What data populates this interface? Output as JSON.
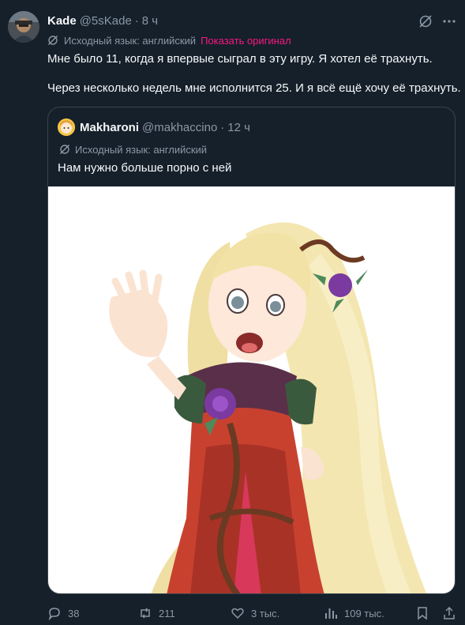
{
  "tweet": {
    "author_name": "Kade",
    "author_handle": "@5sKade",
    "separator": "·",
    "time": "8 ч",
    "translation_note": "Исходный язык: английский",
    "show_original_label": "Показать оригинал",
    "text_line1": "Мне было 11, когда я впервые сыграл в эту игру. Я хотел её трахнуть.",
    "text_line2": "Через несколько недель мне исполнится 25. И я всё ещё хочу её трахнуть."
  },
  "quoted": {
    "author_name": "Makharoni",
    "author_handle": "@makhaccino",
    "separator": "·",
    "time": "12 ч",
    "translation_note": "Исходный язык: английский",
    "text": "Нам нужно больше порно с ней"
  },
  "actions": {
    "replies": "38",
    "retweets": "211",
    "likes": "3 тыс.",
    "views": "109 тыс."
  },
  "icons": {
    "translate": "translate-icon",
    "grok": "grok-icon",
    "more": "more-dots-icon",
    "reply": "reply-icon",
    "retweet": "retweet-icon",
    "like": "heart-icon",
    "views": "views-icon",
    "bookmark": "bookmark-icon",
    "share": "share-icon"
  },
  "colors": {
    "background": "#15202b",
    "text_primary": "#f7f9f9",
    "text_secondary": "#8b98a5",
    "accent_link": "#f91880",
    "border": "#38444d"
  }
}
